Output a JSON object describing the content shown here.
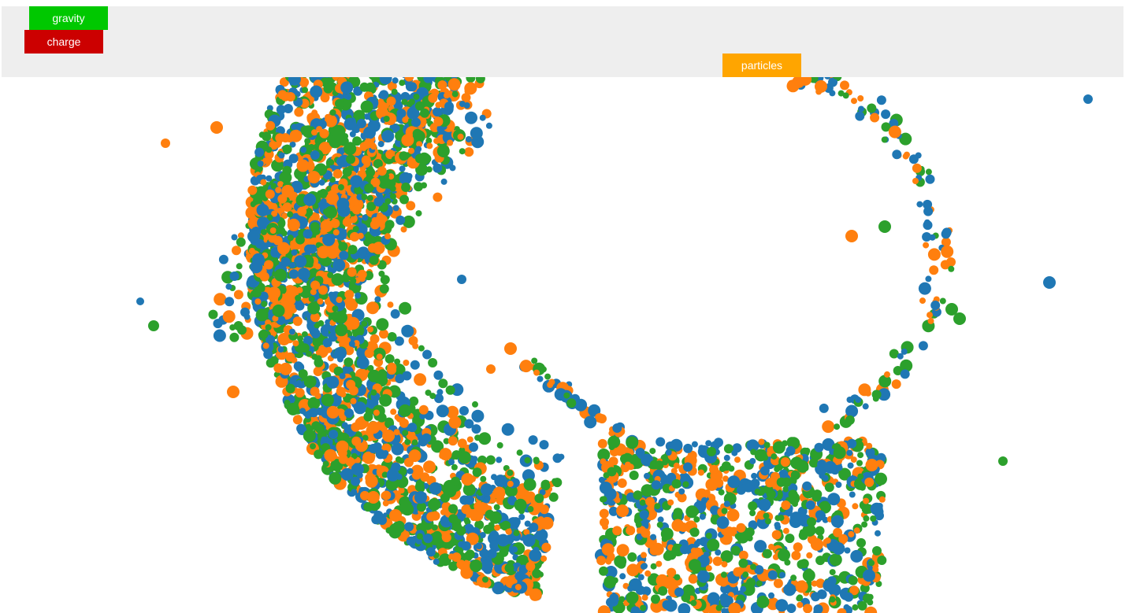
{
  "controls": {
    "gravity_label": "gravity",
    "charge_label": "charge",
    "particles_label": "particles"
  },
  "colors": {
    "panel_background": "#eeeeee",
    "gravity_button": "#00c800",
    "charge_button": "#cc0000",
    "particles_button": "#ffa500",
    "particle_palette": [
      "#1f77b4",
      "#ff7f0e",
      "#2ca02c"
    ]
  }
}
